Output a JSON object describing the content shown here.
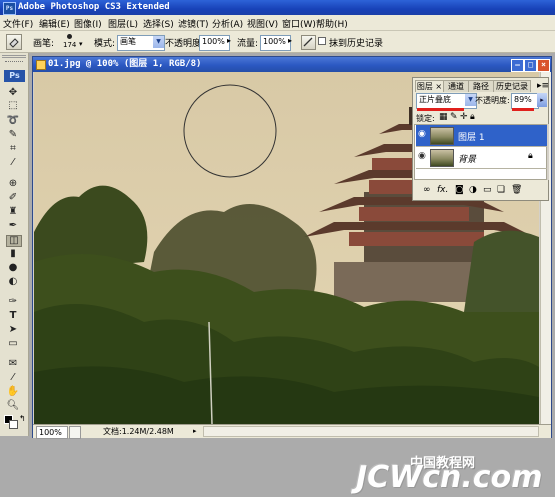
{
  "app": {
    "title": "Adobe Photoshop CS3 Extended",
    "logo": "Ps"
  },
  "menu": [
    "文件(F)",
    "编辑(E)",
    "图像(I)",
    "图层(L)",
    "选择(S)",
    "滤镜(T)",
    "分析(A)",
    "视图(V)",
    "窗口(W)",
    "帮助(H)"
  ],
  "options": {
    "brush_label": "画笔:",
    "brush_size": "174",
    "mode_label": "模式:",
    "mode_value": "画笔",
    "opacity_label": "不透明度:",
    "opacity_value": "100%",
    "flow_label": "流量:",
    "flow_value": "100%",
    "history_label": "抹到历史记录"
  },
  "document": {
    "title": "01.jpg @ 100% (图层 1, RGB/8)",
    "zoom": "100%",
    "doc_info": "文档:1.24M/2.48M"
  },
  "layers_panel": {
    "tabs": [
      "图层",
      "通道",
      "路径",
      "历史记录"
    ],
    "blend_mode": "正片叠底",
    "opacity_label": "不透明度:",
    "opacity_value": "89%",
    "lock_label": "锁定:",
    "layers": [
      {
        "name": "图层 1",
        "selected": true
      },
      {
        "name": "背景",
        "selected": false,
        "locked": true
      }
    ]
  },
  "watermark": {
    "text": "JCWcn.com",
    "cn": "中国教程网"
  },
  "colors": {
    "titlebar": "#1f4fc4",
    "selected_layer": "#2f62c9",
    "accent_red": "#e0201c"
  }
}
